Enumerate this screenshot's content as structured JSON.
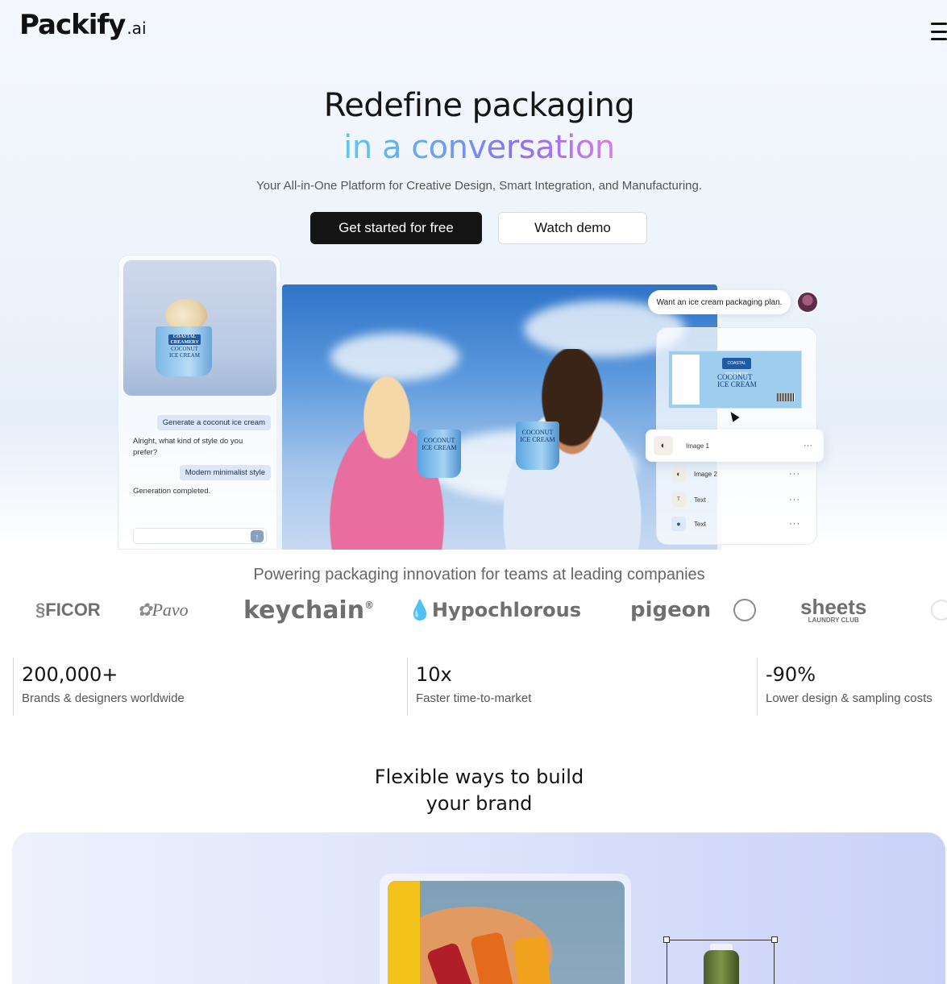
{
  "header": {
    "logo_main": "Packify",
    "logo_suffix": ".ai"
  },
  "hero": {
    "title_line1": "Redefine packaging",
    "title_line2": "in a conversation",
    "subtitle": "Your All-in-One Platform for Creative Design, Smart Integration, and Manufacturing.",
    "cta_primary": "Get started for free",
    "cta_secondary": "Watch demo"
  },
  "chat_demo": {
    "label_brand": "COASTAL CREAMERY",
    "label_product": "COCONUT ICE CREAM",
    "messages": [
      {
        "role": "user",
        "text": "Generate a coconut ice cream"
      },
      {
        "role": "assistant",
        "text": "Alright, what kind of style do you prefer?"
      },
      {
        "role": "user",
        "text": "Modern minimalist style"
      },
      {
        "role": "assistant",
        "text": "Generation completed."
      }
    ]
  },
  "editor_demo": {
    "prompt": "Want an ice cream packaging plan.",
    "label_brand": "COASTAL CREAMERY",
    "label_product": "COCONUT ICE CREAM",
    "layers": [
      {
        "name": "Image 1",
        "icon": "coconut-icon"
      },
      {
        "name": "Image 2",
        "icon": "coconut-icon"
      },
      {
        "name": "Text",
        "icon": "text-icon"
      },
      {
        "name": "Text",
        "icon": "logo-icon"
      }
    ]
  },
  "logos": {
    "heading": "Powering packaging innovation for teams at leading companies",
    "companies": [
      "FICOR",
      "Pavo",
      "keychain",
      "Hypochlorous",
      "pigeon",
      "sheets"
    ],
    "sheets_sub": "LAUNDRY CLUB"
  },
  "stats": [
    {
      "value": "200,000+",
      "caption": "Brands & designers worldwide"
    },
    {
      "value": "10x",
      "caption": "Faster time-to-market"
    },
    {
      "value": "-90%",
      "caption": "Lower design & sampling costs"
    }
  ],
  "section": {
    "title_line1": "Flexible ways to build",
    "title_line2": "your brand"
  }
}
